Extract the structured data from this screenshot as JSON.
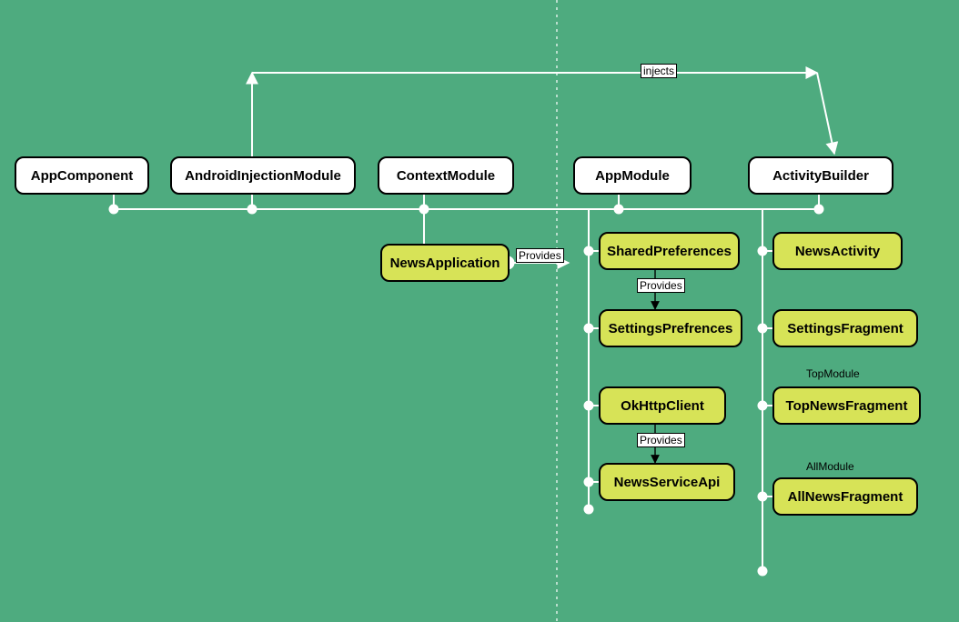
{
  "row1": {
    "appComponent": "AppComponent",
    "androidInjection": "AndroidInjectionModule",
    "contextModule": "ContextModule",
    "appModule": "AppModule",
    "activityBuilder": "ActivityBuilder"
  },
  "context": {
    "newsApplication": "NewsApplication",
    "provides": "Provides"
  },
  "appModuleCol": {
    "sharedPreferences": "SharedPreferences",
    "settingsPrefrences": "SettingsPrefrences",
    "okHttpClient": "OkHttpClient",
    "newsServiceApi": "NewsServiceApi",
    "provides1": "Provides",
    "provides2": "Provides"
  },
  "activityCol": {
    "newsActivity": "NewsActivity",
    "settingsFragment": "SettingsFragment",
    "topModule": "TopModule",
    "topNewsFragment": "TopNewsFragment",
    "allModule": "AllModule",
    "allNewsFragment": "AllNewsFragment"
  },
  "top": {
    "injects": "injects"
  }
}
